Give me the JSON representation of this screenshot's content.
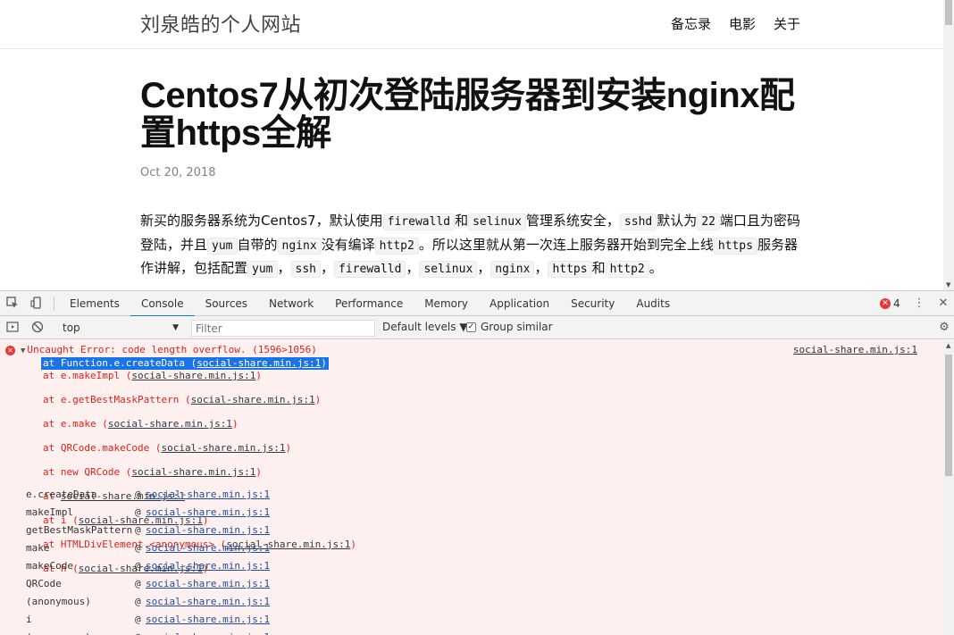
{
  "site": {
    "title": "刘泉皓的个人网站",
    "nav": [
      "备忘录",
      "电影",
      "关于"
    ]
  },
  "post": {
    "title": "Centos7从初次登陆服务器到安装nginx配置https全解",
    "date": "Oct 20, 2018",
    "body": [
      {
        "t": "新买的服务器系统为Centos7，默认使用"
      },
      {
        "c": "firewalld"
      },
      {
        "t": "和"
      },
      {
        "c": "selinux"
      },
      {
        "t": "管理系统安全，"
      },
      {
        "c": "sshd"
      },
      {
        "t": "默认为"
      },
      {
        "c": "22"
      },
      {
        "t": "端口且为密码登陆，并且"
      },
      {
        "c": "yum"
      },
      {
        "t": "自带的"
      },
      {
        "c": "nginx"
      },
      {
        "t": "没有编译"
      },
      {
        "c": "http2"
      },
      {
        "t": "。所以这里就从第一次连上服务器开始到完全上线"
      },
      {
        "c": "https"
      },
      {
        "t": "服务器作讲解，包括配置"
      },
      {
        "c": "yum"
      },
      {
        "t": "，"
      },
      {
        "c": "ssh"
      },
      {
        "t": "，"
      },
      {
        "c": "firewalld"
      },
      {
        "t": "，"
      },
      {
        "c": "selinux"
      },
      {
        "t": "，"
      },
      {
        "c": "nginx"
      },
      {
        "t": "，"
      },
      {
        "c": "https"
      },
      {
        "t": "和"
      },
      {
        "c": "http2"
      },
      {
        "t": "。"
      }
    ]
  },
  "devtools": {
    "tabs": [
      "Elements",
      "Console",
      "Sources",
      "Network",
      "Performance",
      "Memory",
      "Application",
      "Security",
      "Audits"
    ],
    "active_tab": "Console",
    "error_count": "4",
    "toolbar": {
      "context": "top",
      "filter_placeholder": "Filter",
      "levels": "Default levels ▼",
      "group_similar": "Group similar"
    },
    "console": {
      "error_message": "Uncaught Error: code length overflow. (1596>1056)",
      "error_source": "social-share.min.js:1",
      "stack": [
        {
          "pre": "at Function.e.createData (",
          "link": "social-share.min.js:1",
          "post": ")"
        },
        {
          "pre": "at e.makeImpl (",
          "link": "social-share.min.js:1",
          "post": ")"
        },
        {
          "pre": "at e.getBestMaskPattern (",
          "link": "social-share.min.js:1",
          "post": ")"
        },
        {
          "pre": "at e.make (",
          "link": "social-share.min.js:1",
          "post": ")"
        },
        {
          "pre": "at QRCode.makeCode (",
          "link": "social-share.min.js:1",
          "post": ")"
        },
        {
          "pre": "at new QRCode (",
          "link": "social-share.min.js:1",
          "post": ")"
        },
        {
          "pre": "at ",
          "link": "social-share.min.js:1",
          "post": ""
        },
        {
          "pre": "at i (",
          "link": "social-share.min.js:1",
          "post": ")"
        },
        {
          "pre": "at HTMLDivElement.<anonymous> (",
          "link": "social-share.min.js:1",
          "post": ")"
        },
        {
          "pre": "at h (",
          "link": "social-share.min.js:1",
          "post": ")"
        }
      ],
      "async_frames": [
        {
          "fn": "e.createData",
          "src": "social-share.min.js:1"
        },
        {
          "fn": "makeImpl",
          "src": "social-share.min.js:1"
        },
        {
          "fn": "getBestMaskPattern",
          "src": "social-share.min.js:1"
        },
        {
          "fn": "make",
          "src": "social-share.min.js:1"
        },
        {
          "fn": "makeCode",
          "src": "social-share.min.js:1"
        },
        {
          "fn": "QRCode",
          "src": "social-share.min.js:1"
        },
        {
          "fn": "(anonymous)",
          "src": "social-share.min.js:1"
        },
        {
          "fn": "i",
          "src": "social-share.min.js:1"
        },
        {
          "fn": "(anonymous)",
          "src": "social-share.min.js:1"
        }
      ]
    }
  },
  "colors": {
    "accent": "#1a73e8",
    "error_red": "#e0201a",
    "console_error_bg": "#fff0f0"
  }
}
